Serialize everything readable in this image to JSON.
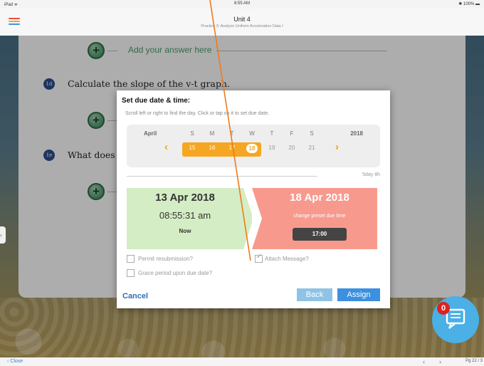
{
  "status_bar": {
    "left": "iPad ᯤ",
    "time": "8:55 AM",
    "battery": "✱ 100% ▬"
  },
  "header": {
    "title": "Unit 4",
    "subtitle": "Practice 3: Analyze Uniform Acceleration Data I",
    "menu_colors": [
      "#e84c4c",
      "#f5a623",
      "#4a90e2",
      "#2eb398"
    ]
  },
  "worksheet": {
    "add_answer_label": "Add your answer here",
    "questions": [
      {
        "badge": "1d",
        "text": "Calculate the slope of the v-t graph."
      },
      {
        "badge": "1e",
        "text": "What does"
      }
    ]
  },
  "dialog": {
    "title": "Set due date & time:",
    "hint": "Scroll left or right to find the day. Click or tap on it to set due date.",
    "calendar": {
      "month": "April",
      "year": "2018",
      "weekdays": [
        "S",
        "M",
        "T",
        "W",
        "T",
        "F",
        "S"
      ],
      "days": [
        "15",
        "16",
        "17",
        "18",
        "19",
        "20",
        "21"
      ],
      "selected_range": [
        "15",
        "16",
        "17",
        "18"
      ],
      "current_day": "18"
    },
    "span": "5day 8h",
    "from": {
      "date": "13 Apr 2018",
      "time": "08:55:31 am",
      "label": "Now"
    },
    "to": {
      "date": "18 Apr 2018",
      "preset_label": "change preset due time",
      "time": "17:00"
    },
    "options": {
      "resubmission": "Permit resubmission?",
      "attach": "Attach Message?",
      "grace": "Grace period upon due date?"
    },
    "buttons": {
      "cancel": "Cancel",
      "back": "Back",
      "assign": "Assign"
    }
  },
  "chat": {
    "badge": "0",
    "icon": "chat-icon"
  },
  "bottom_bar": {
    "close": "Close",
    "page": "Pg 22 / 3"
  },
  "colors": {
    "accent": "#f5a623",
    "assign": "#3d8fe0",
    "from_bg": "#d4edc4",
    "to_bg": "#f79a8d",
    "pen": "#f07a1a"
  }
}
